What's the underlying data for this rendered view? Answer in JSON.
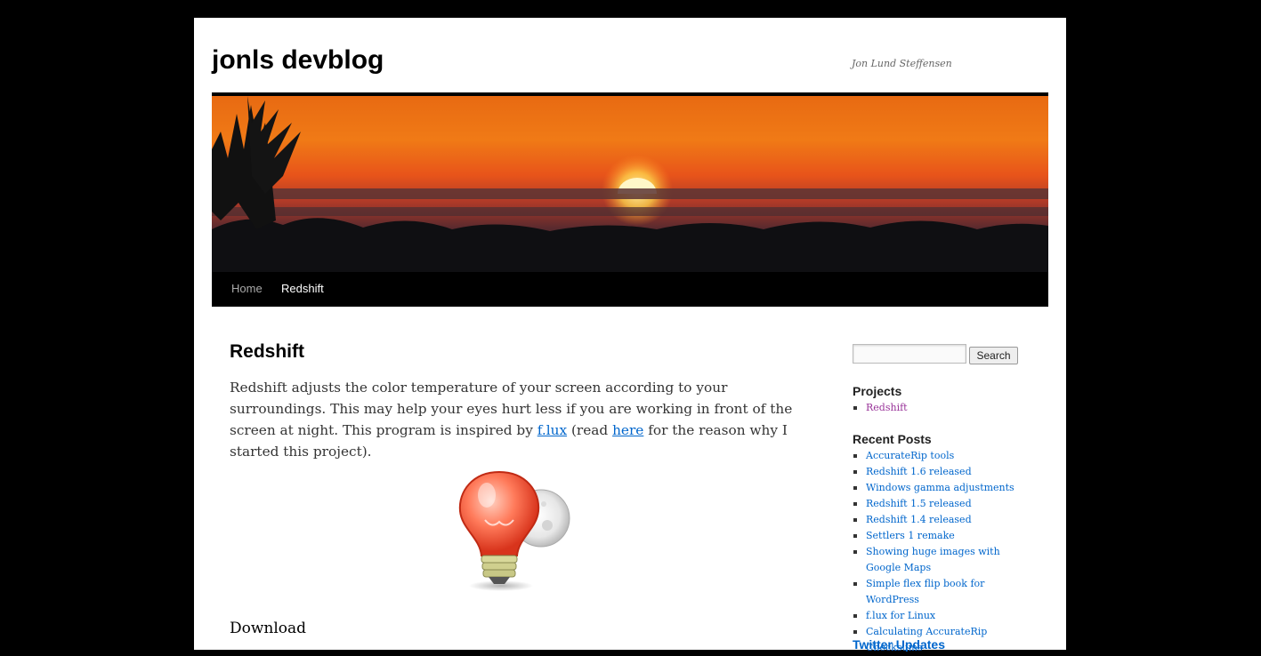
{
  "header": {
    "site_title": "jonls devblog",
    "site_description": "Jon Lund Steffensen"
  },
  "nav": {
    "items": [
      {
        "label": "Home",
        "current": false
      },
      {
        "label": "Redshift",
        "current": true
      }
    ]
  },
  "entry": {
    "title": "Redshift",
    "text_1": "Redshift adjusts the color temperature of your screen according to your surroundings. This may help your eyes hurt less if you are working in front of the screen at night. This program is inspired by ",
    "link_flux": "f.lux",
    "text_2": " (read ",
    "link_here": "here",
    "text_3": " for the reason why I started this project).",
    "download_heading": "Download"
  },
  "sidebar": {
    "search_button": "Search",
    "search_value": "",
    "projects_title": "Projects",
    "projects": [
      "Redshift"
    ],
    "recent_title": "Recent Posts",
    "recent_posts": [
      "AccurateRip tools",
      "Redshift 1.6 released",
      "Windows gamma adjustments",
      "Redshift 1.5 released",
      "Redshift 1.4 released",
      "Settlers 1 remake",
      "Showing huge images with Google Maps",
      "Simple flex flip book for WordPress",
      "f.lux for Linux",
      "Calculating AccurateRip Checksums"
    ],
    "twitter_title": "Twitter Updates"
  },
  "colors": {
    "link": "#0066cc",
    "visited_link": "#993399",
    "nav_bar": "#000000",
    "page_background": "#000000"
  }
}
